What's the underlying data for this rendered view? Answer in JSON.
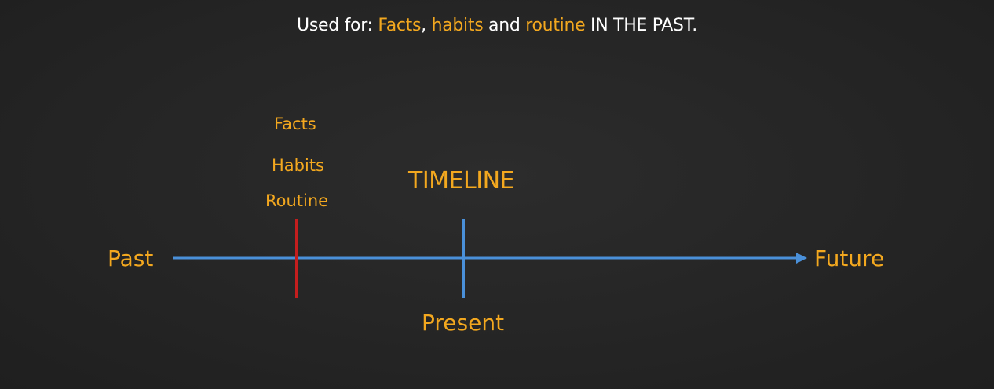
{
  "headline": {
    "prefix": "Used for: ",
    "word1": "Facts",
    "sep1": ", ",
    "word2": "habits",
    "sep2": " and ",
    "word3": "routine",
    "suffix": " IN THE PAST."
  },
  "diagram": {
    "title": "TIMELINE",
    "start_label": "Past",
    "end_label": "Future",
    "present_label": "Present",
    "past_marker_labels": {
      "facts": "Facts",
      "habits": "Habits",
      "routine": "Routine"
    }
  },
  "colors": {
    "background": "#252525",
    "accent": "#f3a81f",
    "headline_text": "#ffffff",
    "timeline_line": "#4a90d9",
    "past_marker": "#c41e1e",
    "present_marker": "#4a90d9"
  }
}
